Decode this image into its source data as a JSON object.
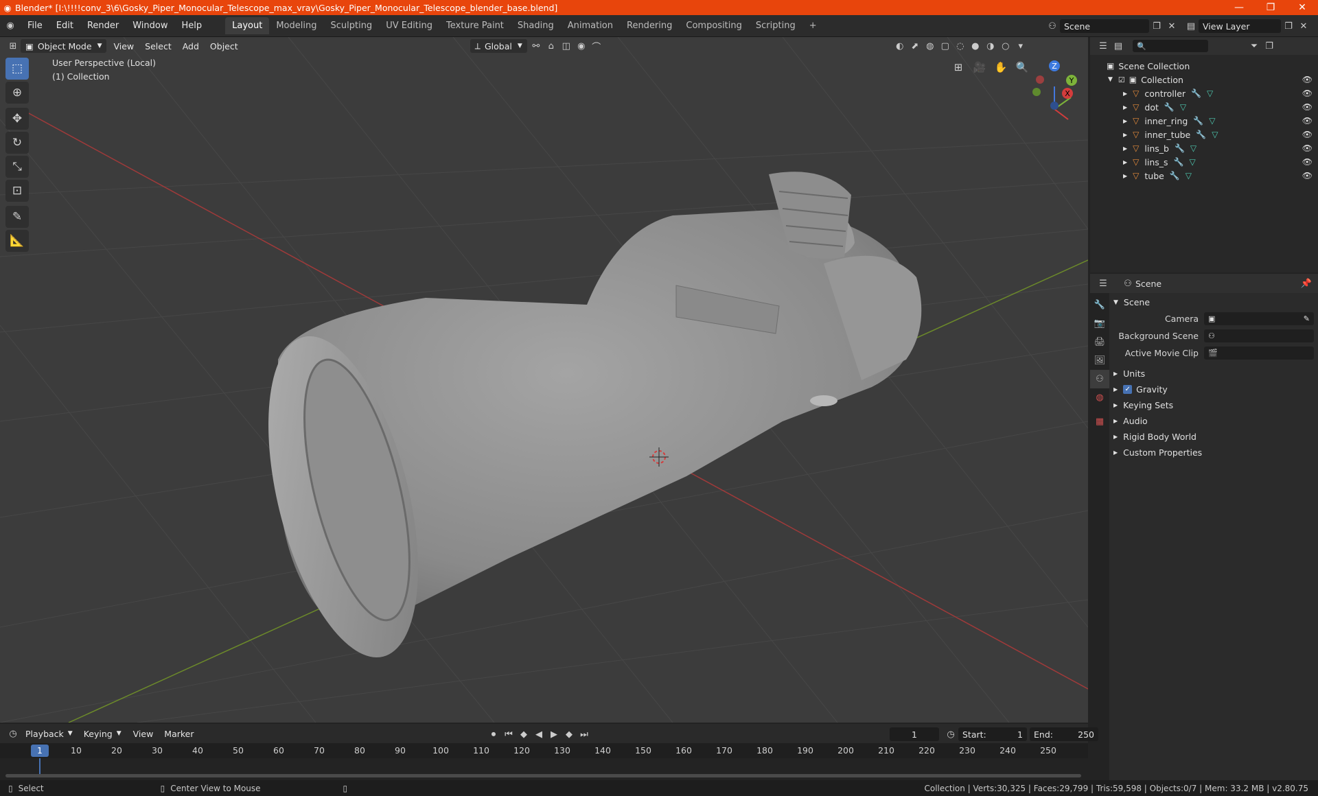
{
  "titlebar": {
    "title": "Blender* [I:\\!!!!conv_3\\6\\Gosky_Piper_Monocular_Telescope_max_vray\\Gosky_Piper_Monocular_Telescope_blender_base.blend]",
    "minimize": "—",
    "restore": "❐",
    "close": "✕"
  },
  "menubar": {
    "items": [
      "File",
      "Edit",
      "Render",
      "Window",
      "Help"
    ]
  },
  "workspaces": {
    "tabs": [
      "Layout",
      "Modeling",
      "Sculpting",
      "UV Editing",
      "Texture Paint",
      "Shading",
      "Animation",
      "Rendering",
      "Compositing",
      "Scripting"
    ],
    "add": "+"
  },
  "scene_selector": {
    "value": "Scene"
  },
  "viewlayer_selector": {
    "value": "View Layer"
  },
  "viewport": {
    "mode": "Object Mode",
    "menus": [
      "View",
      "Select",
      "Add",
      "Object"
    ],
    "orientation": "Global",
    "info_line1": "User Perspective (Local)",
    "info_line2": "(1) Collection",
    "gizmo": {
      "z": "Z",
      "y": "Y",
      "x": "X"
    }
  },
  "outliner": {
    "root": "Scene Collection",
    "collection": "Collection",
    "objects": [
      "controller",
      "dot",
      "inner_ring",
      "inner_tube",
      "lins_b",
      "lins_s",
      "tube"
    ]
  },
  "properties": {
    "header": "Scene",
    "section": "Scene",
    "fields": [
      {
        "label": "Camera"
      },
      {
        "label": "Background Scene"
      },
      {
        "label": "Active Movie Clip"
      }
    ],
    "panels": [
      "Units",
      "Gravity",
      "Keying Sets",
      "Audio",
      "Rigid Body World",
      "Custom Properties"
    ]
  },
  "timeline": {
    "menus": [
      "Playback",
      "Keying",
      "View",
      "Marker"
    ],
    "current_frame": "1",
    "start_label": "Start:",
    "start_value": "1",
    "end_label": "End:",
    "end_value": "250",
    "ruler": [
      "10",
      "20",
      "30",
      "40",
      "50",
      "60",
      "70",
      "80",
      "90",
      "100",
      "110",
      "120",
      "130",
      "140",
      "150",
      "160",
      "170",
      "180",
      "190",
      "200",
      "210",
      "220",
      "230",
      "240",
      "250"
    ],
    "ruler_current": "1"
  },
  "statusbar": {
    "left": "Select",
    "middle": "Center View to Mouse",
    "right": "Collection | Verts:30,325 | Faces:29,799 | Tris:59,598 | Objects:0/7 | Mem: 33.2 MB | v2.80.75"
  }
}
